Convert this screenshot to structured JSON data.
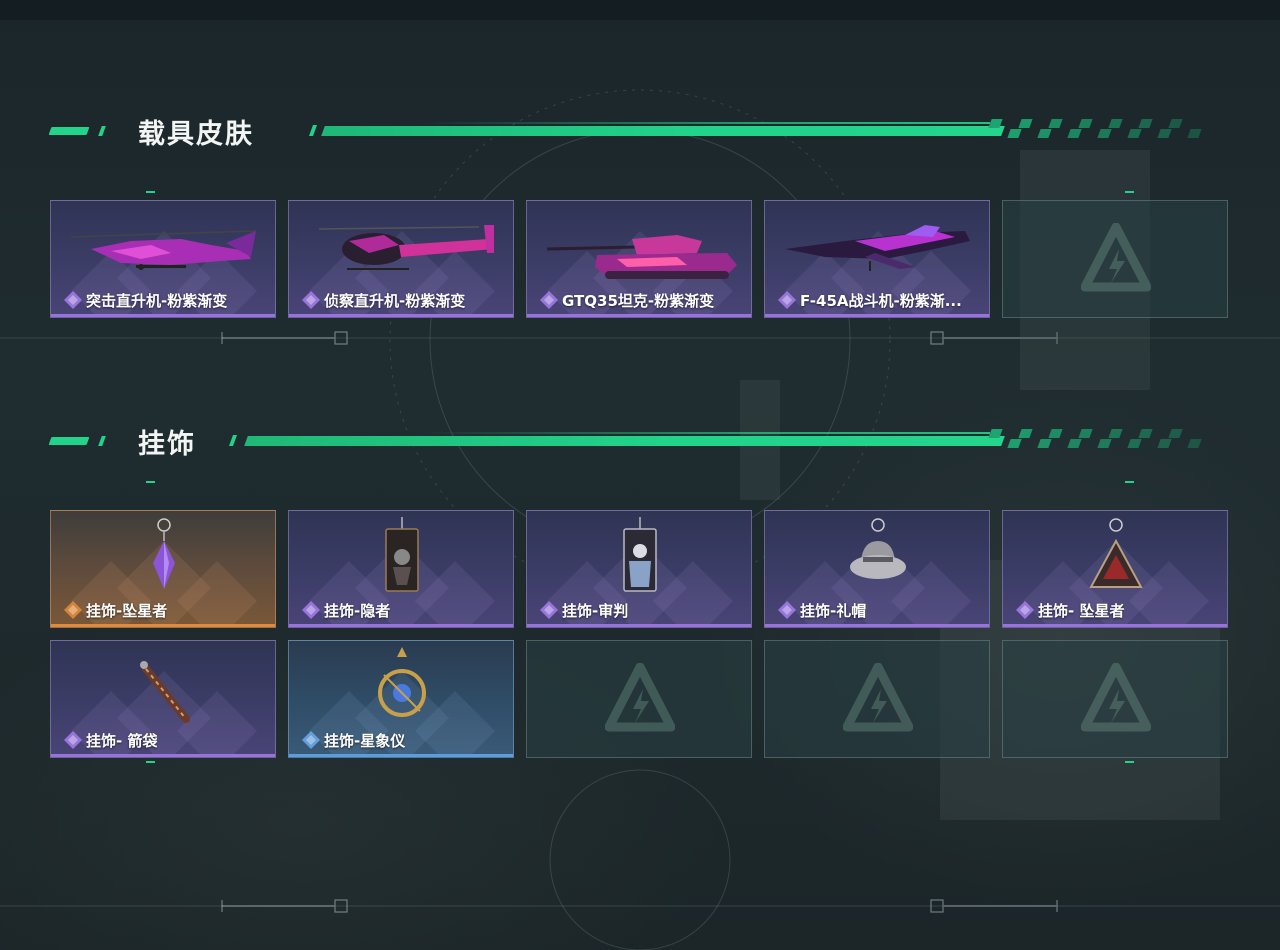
{
  "sections": [
    {
      "title": "载具皮肤",
      "items": [
        {
          "name": "突击直升机-粉紫渐变",
          "rarity": "epic",
          "art": "attack-helicopter"
        },
        {
          "name": "侦察直升机-粉紫渐变",
          "rarity": "epic",
          "art": "scout-helicopter"
        },
        {
          "name": "GTQ35坦克-粉紫渐变",
          "rarity": "epic",
          "art": "tank"
        },
        {
          "name": "F-45A战斗机-粉紫渐...",
          "rarity": "epic",
          "art": "fighter-jet"
        },
        {
          "empty": true
        }
      ]
    },
    {
      "title": "挂饰",
      "items": [
        {
          "name": "挂饰-坠星者",
          "rarity": "legendary",
          "art": "crystal-charm"
        },
        {
          "name": "挂饰-隐者",
          "rarity": "epic",
          "art": "hermit-card-charm"
        },
        {
          "name": "挂饰-审判",
          "rarity": "epic",
          "art": "judgement-card-charm"
        },
        {
          "name": "挂饰-礼帽",
          "rarity": "epic",
          "art": "fedora-charm"
        },
        {
          "name": "挂饰- 坠星者",
          "rarity": "epic",
          "art": "triangle-charm"
        },
        {
          "name": "挂饰- 箭袋",
          "rarity": "epic",
          "art": "quiver-charm"
        },
        {
          "name": "挂饰-星象仪",
          "rarity": "rare",
          "art": "astrolabe-charm"
        },
        {
          "empty": true
        },
        {
          "empty": true
        },
        {
          "empty": true
        }
      ]
    }
  ],
  "colors": {
    "accent": "#22d38a",
    "epic": "#9a72e0",
    "legendary": "#e08a3a",
    "rare": "#5b9ee0"
  }
}
